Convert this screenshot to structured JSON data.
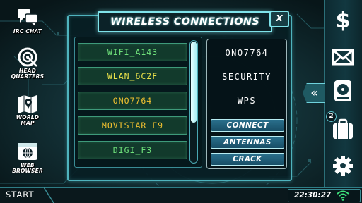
{
  "window": {
    "title": "WIRELESS CONNECTIONS",
    "close_label": "X"
  },
  "sidebar": {
    "items": [
      {
        "label": "IRC CHAT",
        "icon": "chat-bubbles-icon"
      },
      {
        "label": "HEAD\nQUARTERS",
        "icon": "target-icon"
      },
      {
        "label": "WORLD\nMAP",
        "icon": "map-pin-icon"
      },
      {
        "label": "WEB\nBROWSER",
        "icon": "globe-window-icon"
      }
    ]
  },
  "networks": [
    {
      "ssid": "WIFI_A143",
      "color": "#6ee07a"
    },
    {
      "ssid": "WLAN_6C2F",
      "color": "#e8e04a"
    },
    {
      "ssid": "ONO7764",
      "color": "#f0c030"
    },
    {
      "ssid": "MOVISTAR_F9",
      "color": "#f0c030"
    },
    {
      "ssid": "DIGI_F3",
      "color": "#6ee07a"
    }
  ],
  "selected": {
    "ssid": "ONO7764",
    "security_label": "SECURITY",
    "security_type": "WPS"
  },
  "actions": {
    "connect": "CONNECT",
    "antennas": "ANTENNAS",
    "crack": "CRACK"
  },
  "right_bar": {
    "buttons": [
      "dollar-icon",
      "mail-icon",
      "hard-drive-icon",
      "briefcase-icon",
      "gear-icon"
    ],
    "briefcase_badge": "2",
    "collapse_label": "«"
  },
  "taskbar": {
    "start_label": "START",
    "clock": "22:30:27"
  },
  "colors": {
    "accent": "#4fb3bd",
    "title_glow": "#7fe3ea",
    "green_signal": "#3be07a"
  }
}
